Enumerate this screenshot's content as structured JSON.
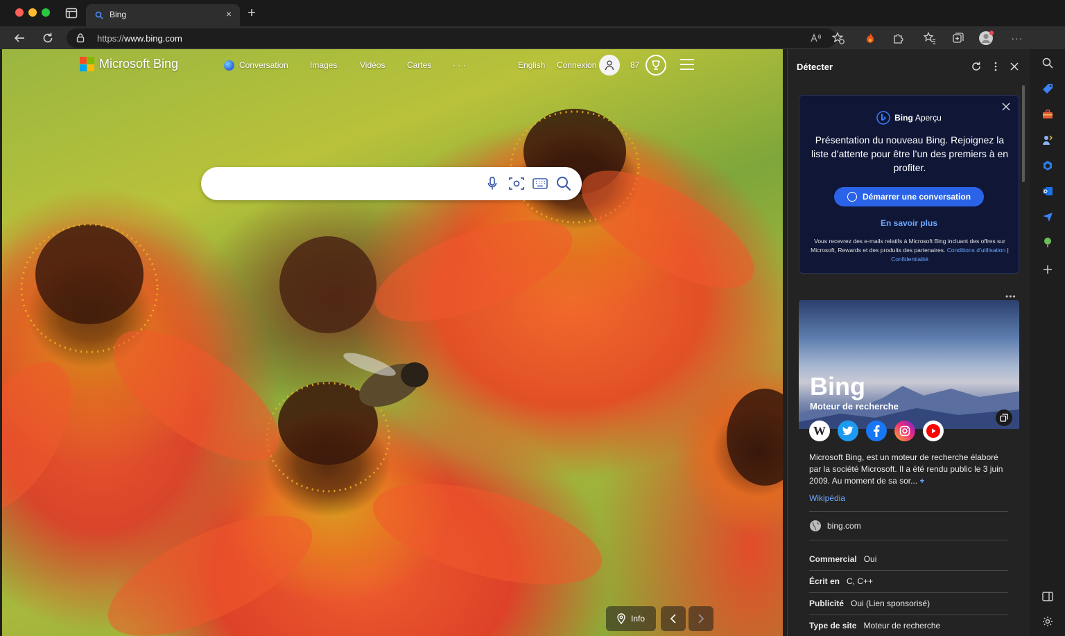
{
  "tab": {
    "title": "Bing",
    "close": "×",
    "new_tab": "+"
  },
  "toolbar": {
    "url_scheme": "https://",
    "url_host": "www.bing.com",
    "more": "···"
  },
  "bing": {
    "logo_text": "Microsoft Bing",
    "nav": [
      "Conversation",
      "Images",
      "Vidéos",
      "Cartes",
      "· · ·"
    ],
    "language": "English",
    "signin": "Connexion",
    "rewards_count": "87",
    "search": {
      "placeholder": ""
    },
    "info": "Info"
  },
  "panel": {
    "title": "Détecter",
    "promo": {
      "brand_bold": "Bing",
      "brand_rest": "Aperçu",
      "message": "Présentation du nouveau Bing. Rejoignez la liste d’attente pour être l’un des premiers à en profiter.",
      "cta": "Démarrer une conversation",
      "learn_more": "En savoir plus",
      "fine_print": "Vous recevrez des e-mails relatifs à Microsoft Bing incluant des offres sur Microsoft, Rewards et des produits des partenaires.",
      "link_terms": "Conditions d’utilisation",
      "separator": "|",
      "link_privacy": "Confidentialité"
    },
    "card": {
      "title": "Bing",
      "subtitle": "Moteur de recherche",
      "description": "Microsoft Bing, est un moteur de recherche élaboré par la société Microsoft. Il a été rendu public le 3 juin 2009. Au moment de sa sor...",
      "more": "+",
      "source": "Wikipédia",
      "website": "bing.com",
      "socials": [
        "wikipedia-icon",
        "twitter-icon",
        "facebook-icon",
        "instagram-icon",
        "youtube-icon"
      ],
      "facts": [
        {
          "label": "Commercial",
          "value": "Oui"
        },
        {
          "label": "Écrit en",
          "value": "C, C++"
        },
        {
          "label": "Publicité",
          "value": "Oui (Lien sponsorisé)"
        },
        {
          "label": "Type de site",
          "value": "Moteur de recherche"
        }
      ]
    }
  },
  "colors": {
    "accent": "#2a63e8",
    "link": "#6ea8ff",
    "ms_red": "#f25022",
    "ms_green": "#7fba00",
    "ms_blue": "#00a4ef",
    "ms_yellow": "#ffb900"
  }
}
